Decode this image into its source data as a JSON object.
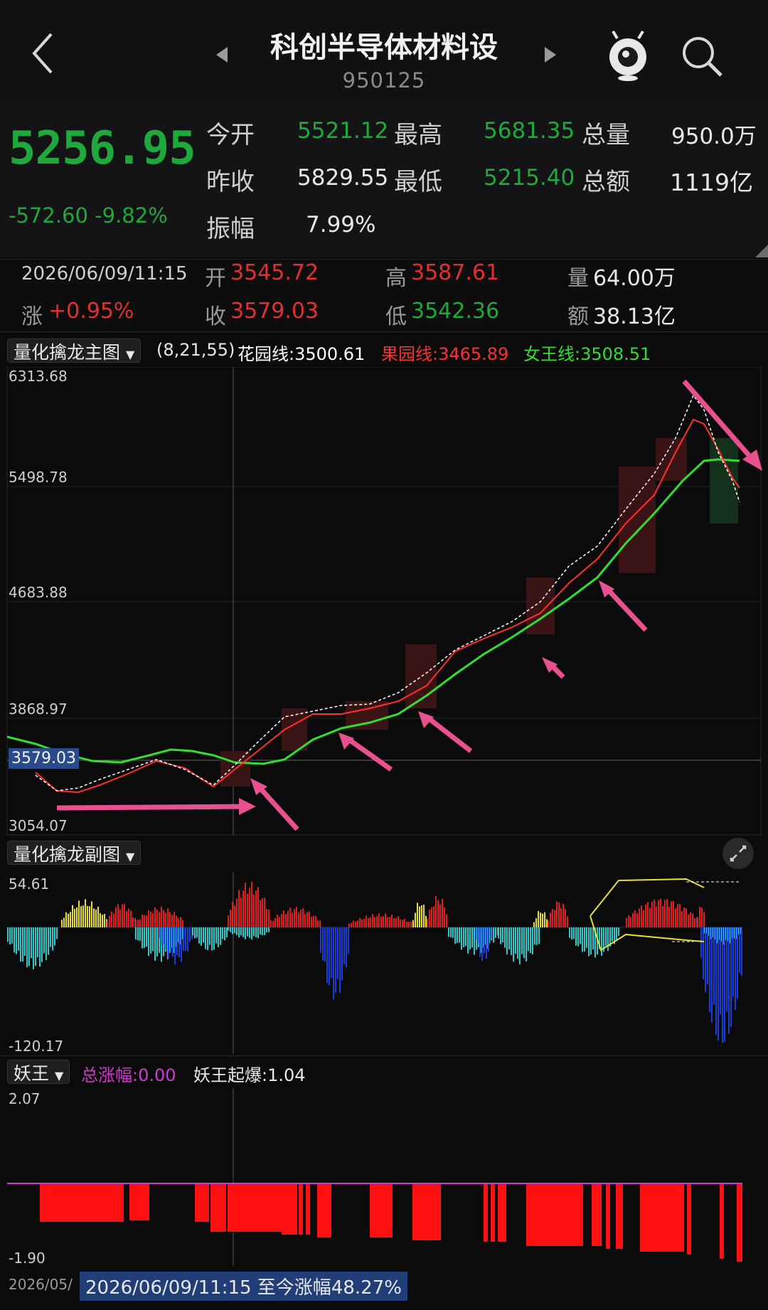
{
  "header": {
    "title": "科创半导体材料设",
    "code": "950125"
  },
  "quote": {
    "price": "5256.95",
    "change": "-572.60",
    "change_pct": "-9.82%",
    "rows": [
      {
        "l1": "今开",
        "v1": "5521.12",
        "l2": "最高",
        "v2": "5681.35",
        "l3": "总量",
        "v3": "950.0万"
      },
      {
        "l1": "昨收",
        "v1": "5829.55",
        "l2": "最低",
        "v2": "5215.40",
        "l3": "总额",
        "v3": "1119亿"
      }
    ],
    "amp_label": "振幅",
    "amp_value": "7.99%"
  },
  "info": {
    "datetime": "2026/06/09/11:15",
    "open_label": "开",
    "open": "3545.72",
    "high_label": "高",
    "high": "3587.61",
    "vol_label": "量",
    "vol": "64.00万",
    "chg_label": "涨",
    "chg": "+0.95%",
    "close_label": "收",
    "close": "3579.03",
    "low_label": "低",
    "low": "3542.36",
    "amt_label": "额",
    "amt": "38.13亿"
  },
  "main_chart": {
    "name": "量化擒龙主图",
    "params": "(8,21,55)",
    "line1": "花园线:3500.61",
    "line2": "果园线:3465.89",
    "line3": "女王线:3508.51",
    "y_labels": [
      "6313.68",
      "5498.78",
      "4683.88",
      "3868.97",
      "3054.07"
    ],
    "cursor_value": "3579.03",
    "colors": {
      "line1": "#ffffff",
      "line2": "#ff3030",
      "line3": "#33dd33",
      "arrow": "#e8508f"
    }
  },
  "sub_chart": {
    "name": "量化擒龙副图",
    "y_max": "54.61",
    "y_min": "-120.17"
  },
  "yaowang": {
    "name": "妖王",
    "total_label": "总涨幅:0.00",
    "burst_label": "妖王起爆:1.04",
    "y_max": "2.07",
    "y_min": "-1.90"
  },
  "footer": {
    "date_prefix": "2026/05/",
    "range_text": "2026/06/09/11:15 至今涨幅48.27%"
  }
}
